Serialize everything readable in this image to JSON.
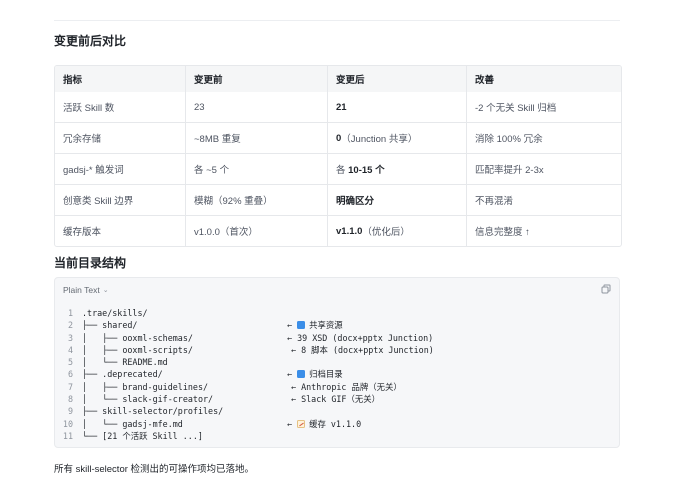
{
  "section_compare": {
    "title": "变更前后对比"
  },
  "table": {
    "headers": [
      "指标",
      "变更前",
      "变更后",
      "改善"
    ],
    "rows": [
      {
        "metric": "活跃 Skill 数",
        "before": "23",
        "after_bold": "21",
        "after_rest": "",
        "improve": "-2 个无关 Skill 归档"
      },
      {
        "metric": "冗余存储",
        "before": "~8MB 重复",
        "after_bold": "0",
        "after_rest": "（Junction 共享）",
        "improve": "消除 100% 冗余"
      },
      {
        "metric": "gadsj-* 触发词",
        "before": "各 ~5 个",
        "after_pre": "各 ",
        "after_bold": "10-15 个",
        "after_rest": "",
        "improve": "匹配率提升 2-3x"
      },
      {
        "metric": "创意类 Skill 边界",
        "before": "模糊（92% 重叠）",
        "after_bold": "明确区分",
        "after_rest": "",
        "improve": "不再混淆"
      },
      {
        "metric": "缓存版本",
        "before": "v1.0.0（首次）",
        "after_bold": "v1.1.0",
        "after_rest": "（优化后）",
        "improve": "信息完整度 ↑"
      }
    ]
  },
  "section_dir": {
    "title": "当前目录结构"
  },
  "code_block": {
    "language": "Plain Text",
    "lines": [
      {
        "n": "1",
        "text": ".trae/skills/",
        "comment": ""
      },
      {
        "n": "2",
        "text": "├── shared/",
        "comment": "← ",
        "emoji": "blue",
        "comment_text": "共享资源"
      },
      {
        "n": "3",
        "text": "│   ├── ooxml-schemas/",
        "comment": "← 39 XSD (docx+pptx Junction)"
      },
      {
        "n": "4",
        "text": "│   ├── ooxml-scripts/",
        "comment": "← 8 脚本 (docx+pptx Junction)"
      },
      {
        "n": "5",
        "text": "│   └── README.md",
        "comment": ""
      },
      {
        "n": "6",
        "text": "├── .deprecated/",
        "comment": "← ",
        "emoji": "blue",
        "comment_text": "归档目录"
      },
      {
        "n": "7",
        "text": "│   ├── brand-guidelines/",
        "comment": "← Anthropic 品牌（无关）"
      },
      {
        "n": "8",
        "text": "│   └── slack-gif-creator/",
        "comment": "← Slack GIF（无关）"
      },
      {
        "n": "9",
        "text": "├── skill-selector/profiles/",
        "comment": ""
      },
      {
        "n": "10",
        "text": "│   └── gadsj-mfe.md",
        "comment": "← ",
        "emoji": "memo",
        "comment_text": "缓存 v1.1.0"
      },
      {
        "n": "11",
        "text": "└── [21 个活跃 Skill ...]",
        "comment": ""
      }
    ]
  },
  "footer": {
    "text": "所有 skill-selector 检测出的可操作项均已落地。"
  }
}
